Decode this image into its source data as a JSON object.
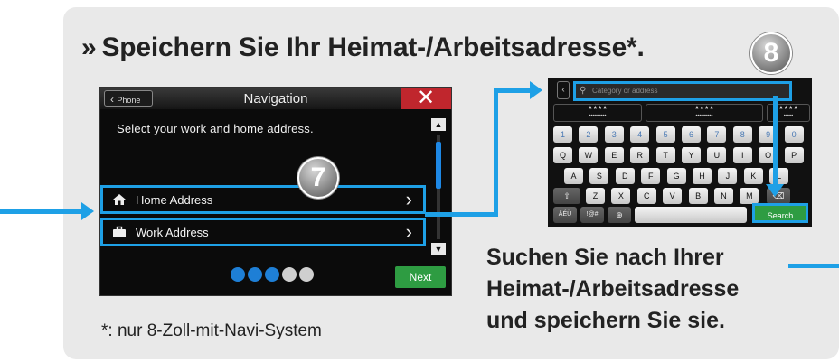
{
  "title": {
    "chevron": "»",
    "text": "Speichern Sie Ihr Heimat-/Arbeitsadresse*."
  },
  "badges": {
    "step8": "8",
    "step7": "7"
  },
  "nav_screen": {
    "back_label": "Phone",
    "title": "Navigation",
    "close_label": "✕",
    "instruction": "Select your work and home address.",
    "items": [
      {
        "label": "Home Address",
        "icon": "home-icon"
      },
      {
        "label": "Work Address",
        "icon": "briefcase-icon"
      }
    ],
    "next_label": "Next",
    "page_dots": {
      "total": 5,
      "active": 3
    }
  },
  "footnote": "*: nur 8-Zoll-mit-Navi-System",
  "keyboard": {
    "placeholder": "Category or address",
    "numbers": [
      "1",
      "2",
      "3",
      "4",
      "5",
      "6",
      "7",
      "8",
      "9",
      "0"
    ],
    "row1": [
      "Q",
      "W",
      "E",
      "R",
      "T",
      "Y",
      "U",
      "I",
      "O",
      "P"
    ],
    "row2": [
      "A",
      "S",
      "D",
      "F",
      "G",
      "H",
      "J",
      "K",
      "L"
    ],
    "row3": [
      "Z",
      "X",
      "C",
      "V",
      "B",
      "N",
      "M"
    ],
    "mode_keys": [
      "ÄÉÜ",
      "!@#"
    ],
    "search_label": "Search"
  },
  "description": [
    "Suchen Sie nach Ihrer",
    "Heimat-/Arbeitsadresse",
    "und speichern Sie sie."
  ],
  "colors": {
    "accent": "#1ea0e6",
    "close": "#c0262d",
    "next": "#2e9c42"
  }
}
